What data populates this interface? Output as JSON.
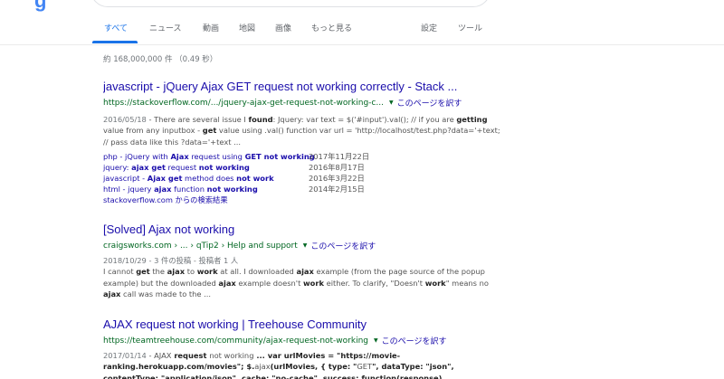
{
  "logo_fragment": "g",
  "tabs": [
    {
      "label": "すべて"
    },
    {
      "label": "ニュース"
    },
    {
      "label": "動画"
    },
    {
      "label": "地図"
    },
    {
      "label": "画像"
    },
    {
      "label": "もっと見る"
    },
    {
      "label": "設定"
    },
    {
      "label": "ツール"
    }
  ],
  "stats": "約 168,000,000 件 （0.49 秒）",
  "translate_label": "このページを訳す",
  "results": [
    {
      "title": "javascript - jQuery Ajax GET request not working correctly - Stack ...",
      "url": "https://stackoverflow.com/.../jquery-ajax-get-request-not-working-c...",
      "date": "2016/05/18",
      "sitelinks": [
        {
          "date": "2017年11月22日"
        },
        {
          "date": "2016年8月17日"
        },
        {
          "date": "2016年3月22日"
        },
        {
          "date": "2014年2月15日"
        }
      ],
      "more": "stackoverflow.com からの検索結果"
    },
    {
      "title": "[Solved] Ajax not working",
      "url": "craigsworks.com › ... › qTip2 › Help and support",
      "date": "2018/10/29",
      "meta": "3 件の投稿 - 投稿者 1 人"
    },
    {
      "title": "AJAX request not working | Treehouse Community",
      "url": "https://teamtreehouse.com/community/ajax-request-not-working",
      "date": "2017/01/14"
    }
  ],
  "snippets": {
    "r1": [
      "There are several issue I ",
      "found",
      ": Jquery: var text = $('#input').val(); // if you are ",
      "getting",
      " value from any inputbox - ",
      "get",
      " value using .val() function var url = 'http://localhost/test.php?data='+text; // pass data like this ?data='+text ..."
    ],
    "r2": [
      "I cannot ",
      "get",
      " the ",
      "ajax",
      " to ",
      "work",
      " at all. I downloaded ",
      "ajax",
      " example (from the page source of the popup example) but the downloaded ",
      "ajax",
      " example doesn't ",
      "work",
      " either. To clarify, \"Doesn't ",
      "work",
      "\" means no ",
      "ajax",
      " call was made to the ..."
    ],
    "r3": [
      "AJAX",
      " request ",
      "not working",
      " ... var urlMovies = \"https://movie-ranking.herokuapp.com/movies\"; $.",
      "ajax",
      "(urlMovies, { type: \"",
      "GET",
      "\", dataType: \"json\", contentType: \"application/json\", cache: \"no-cache\", success: function(response) ..."
    ]
  },
  "sitelink_texts": [
    [
      "php - jQuery with ",
      "Ajax",
      " request using ",
      "GET not working"
    ],
    [
      "jquery: ",
      "ajax get",
      " request ",
      "not working"
    ],
    [
      "javascript - ",
      "Ajax get",
      " method does ",
      "not work"
    ],
    [
      "html - jquery ",
      "ajax",
      " function ",
      "not working"
    ]
  ]
}
